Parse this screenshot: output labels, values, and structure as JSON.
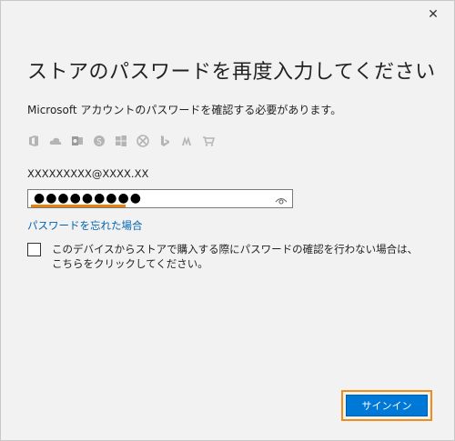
{
  "window": {
    "close_glyph": "✕"
  },
  "heading": "ストアのパスワードを再度入力してください",
  "description": "Microsoft アカウントのパスワードを確認する必要があります。",
  "service_icons": [
    "office-icon",
    "onedrive-icon",
    "outlook-icon",
    "skype-icon",
    "windows-icon",
    "xbox-icon",
    "bing-icon",
    "msn-icon",
    "store-icon"
  ],
  "account_email": "XXXXXXXXX@XXXX.XX",
  "password": {
    "masked_value": "●●●●●●●●●"
  },
  "forgot_link": "パスワードを忘れた場合",
  "skip_check_label": "このデバイスからストアで購入する際にパスワードの確認を行わない場合は、こちらをクリックしてください。",
  "signin_label": "サインイン",
  "colors": {
    "accent": "#0078d7",
    "link": "#0063b1",
    "highlight": "#f08c1a",
    "icon_gray": "#b4b4b4"
  }
}
